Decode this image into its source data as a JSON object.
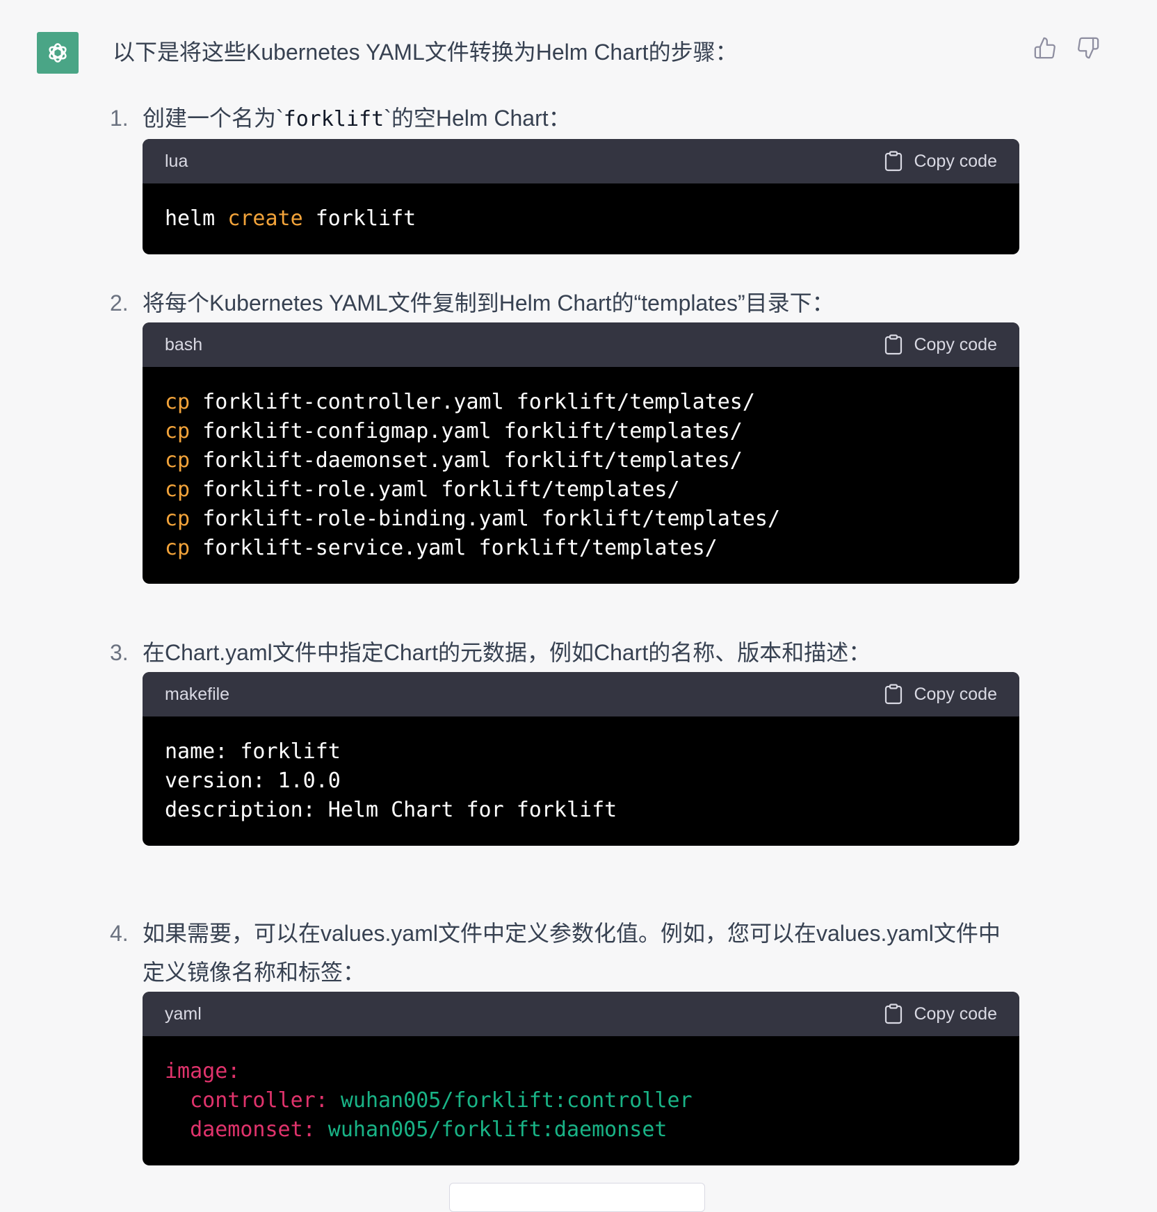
{
  "intro": "以下是将这些Kubernetes YAML文件转换为Helm Chart的步骤：",
  "copy_label": "Copy code",
  "steps": [
    {
      "num": "1.",
      "text_before": "创建一个名为`",
      "inline_code": "forklift",
      "text_after": "`的空Helm Chart：",
      "lang": "lua",
      "lines": [
        {
          "kw": "",
          "text": "helm "
        },
        {
          "kw": "create",
          "text": " forklift"
        }
      ]
    },
    {
      "num": "2.",
      "text": "将每个Kubernetes YAML文件复制到Helm Chart的“templates”目录下：",
      "lang": "bash",
      "lines": [
        {
          "kw": "cp",
          "text": " forklift-controller.yaml forklift/templates/"
        },
        {
          "kw": "cp",
          "text": " forklift-configmap.yaml forklift/templates/"
        },
        {
          "kw": "cp",
          "text": " forklift-daemonset.yaml forklift/templates/"
        },
        {
          "kw": "cp",
          "text": " forklift-role.yaml forklift/templates/"
        },
        {
          "kw": "cp",
          "text": " forklift-role-binding.yaml forklift/templates/"
        },
        {
          "kw": "cp",
          "text": " forklift-service.yaml forklift/templates/"
        }
      ]
    },
    {
      "num": "3.",
      "text": "在Chart.yaml文件中指定Chart的元数据，例如Chart的名称、版本和描述：",
      "lang": "makefile",
      "lines": [
        {
          "text": "name: forklift"
        },
        {
          "text": "version: 1.0.0"
        },
        {
          "text": "description: Helm Chart for forklift"
        }
      ]
    },
    {
      "num": "4.",
      "text": "如果需要，可以在values.yaml文件中定义参数化值。例如，您可以在values.yaml文件中定义镜像名称和标签：",
      "lang": "yaml",
      "lines": [
        {
          "key": "image:",
          "val": ""
        },
        {
          "key": "  controller:",
          "val": " wuhan005/forklift:controller"
        },
        {
          "key": "  daemonset:",
          "val": " wuhan005/forklift:daemonset"
        }
      ]
    }
  ],
  "icons": {
    "avatar": "openai-logo-icon",
    "like": "thumbs-up-icon",
    "dislike": "thumbs-down-icon",
    "copy": "clipboard-icon"
  },
  "colors": {
    "avatar_bg": "#4aa586",
    "code_header_bg": "#343541",
    "code_bg": "#000000",
    "keyword": "#f2a33a",
    "yaml_key": "#e0336c",
    "yaml_value": "#19b386"
  }
}
